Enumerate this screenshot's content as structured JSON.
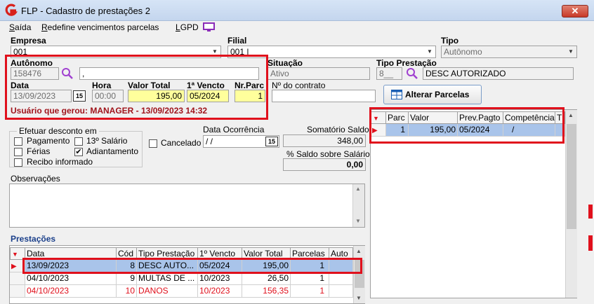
{
  "window": {
    "title": "FLP - Cadastro de prestações 2",
    "close_label": "✕"
  },
  "menu": {
    "items": [
      {
        "prefix": "S",
        "rest": "aída"
      },
      {
        "prefix": "R",
        "rest": "edefine vencimentos parcelas"
      },
      {
        "prefix": "L",
        "rest": "GPD"
      }
    ]
  },
  "form": {
    "empresa": {
      "label": "Empresa",
      "value": "001"
    },
    "filial": {
      "label": "Filial",
      "value": "001 |"
    },
    "tipo": {
      "label": "Tipo",
      "value": "Autônomo"
    },
    "autonomo": {
      "label": "Autônomo",
      "code": "158476",
      "name": ","
    },
    "situacao": {
      "label": "Situação",
      "value": "Ativo"
    },
    "tipo_prestacao": {
      "label": "Tipo Prestação",
      "code": "8__",
      "value": "DESC AUTORIZADO"
    },
    "data": {
      "label": "Data",
      "value": "13/09/2023",
      "cal": "15"
    },
    "hora": {
      "label": "Hora",
      "value": "00:00"
    },
    "valor_total": {
      "label": "Valor Total",
      "value": "195,00"
    },
    "primeiro_vencto": {
      "label": "1ª Vencto",
      "value": "05/2024"
    },
    "nr_parc": {
      "label": "Nr.Parc",
      "value": "1"
    },
    "nr_contrato": {
      "label": "Nº do contrato",
      "value": ""
    },
    "usuario": "Usuário que gerou: MANAGER - 13/09/2023 14:32",
    "alterar_parcelas": "Alterar Parcelas",
    "desconto": {
      "title": "Efetuar desconto em",
      "options": [
        {
          "label": "Pagamento",
          "checked": false
        },
        {
          "label": "13º Salário",
          "checked": false
        },
        {
          "label": "Férias",
          "checked": false
        },
        {
          "label": "Adiantamento",
          "checked": true
        },
        {
          "label": "Recibo informado",
          "checked": false
        }
      ]
    },
    "cancelado": {
      "label": "Cancelado",
      "checked": false
    },
    "data_ocorrencia": {
      "label": "Data Ocorrência",
      "value": " / /",
      "cal": "15"
    },
    "somatorio_saldo": {
      "label": "Somatório Saldo",
      "value": "348,00"
    },
    "pct_saldo": {
      "label": "% Saldo sobre Salário",
      "value": "0,00"
    },
    "observacoes": {
      "label": "Observações",
      "value": ""
    }
  },
  "parcelas": {
    "headers": [
      "Parc",
      "Valor",
      "Prev.Pagto",
      "Competência",
      "T"
    ],
    "rows": [
      {
        "parc": "1",
        "valor": "195,00",
        "prev": "05/2024",
        "comp": "/"
      }
    ]
  },
  "prestacoes": {
    "title": "Prestações",
    "headers": [
      "Data",
      "Cód",
      "Tipo Prestação",
      "1º Vencto",
      "Valor Total",
      "Parcelas",
      "Auto"
    ],
    "rows": [
      {
        "data": "13/09/2023",
        "cod": "8",
        "tipo": "DESC AUTO...",
        "vencto": "05/2024",
        "valor": "195,00",
        "parcelas": "1",
        "red": false,
        "selected": true
      },
      {
        "data": "04/10/2023",
        "cod": "9",
        "tipo": "MULTAS DE ...",
        "vencto": "10/2023",
        "valor": "26,50",
        "parcelas": "1",
        "red": false,
        "selected": false
      },
      {
        "data": "04/10/2023",
        "cod": "10",
        "tipo": "DANOS",
        "vencto": "10/2023",
        "valor": "156,35",
        "parcelas": "1",
        "red": true,
        "selected": false
      }
    ]
  },
  "colors": {
    "highlight": "#e0101c",
    "selection": "#a9c4ea",
    "yellow_field": "#ffff9c"
  }
}
